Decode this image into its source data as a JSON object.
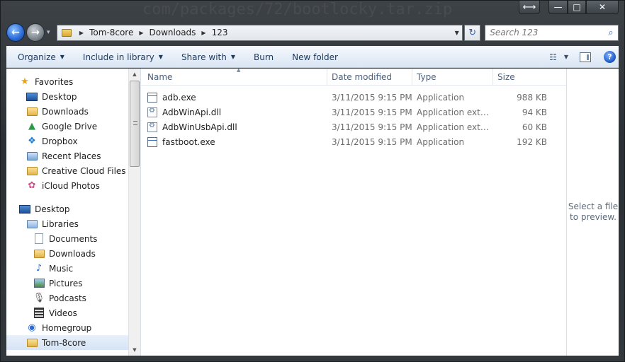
{
  "window": {
    "ghost_text": "com/packages/72/bootlocky.tar.zip",
    "caption": {
      "resize": "⟷",
      "minimize": "—",
      "maximize": "□",
      "close": "✕"
    }
  },
  "nav": {
    "back": "←",
    "forward": "→",
    "history_drop": "▾",
    "breadcrumbs": [
      "Tom-8core",
      "Downloads",
      "123"
    ],
    "address_drop": "▼",
    "refresh": "↻",
    "search_placeholder": "Search 123",
    "search_icon": "⌕"
  },
  "toolbar": {
    "organize": "Organize",
    "include_in_library": "Include in library",
    "share_with": "Share with",
    "burn": "Burn",
    "new_folder": "New folder",
    "view_icon": "☷",
    "help": "?"
  },
  "sidebar": {
    "favorites": {
      "label": "Favorites",
      "items": [
        "Desktop",
        "Downloads",
        "Google Drive",
        "Dropbox",
        "Recent Places",
        "Creative Cloud Files",
        "iCloud Photos"
      ]
    },
    "tree": {
      "desktop": "Desktop",
      "libraries": "Libraries",
      "library_items": [
        "Documents",
        "Downloads",
        "Music",
        "Pictures",
        "Podcasts",
        "Videos"
      ],
      "homegroup": "Homegroup",
      "user": "Tom-8core"
    }
  },
  "columns": {
    "name": "Name",
    "date": "Date modified",
    "type": "Type",
    "size": "Size"
  },
  "files": [
    {
      "name": "adb.exe",
      "date": "3/11/2015 9:15 PM",
      "type": "Application",
      "size": "988 KB",
      "icon": "app-icon"
    },
    {
      "name": "AdbWinApi.dll",
      "date": "3/11/2015 9:15 PM",
      "type": "Application extens...",
      "size": "94 KB",
      "icon": "dll-icon"
    },
    {
      "name": "AdbWinUsbApi.dll",
      "date": "3/11/2015 9:15 PM",
      "type": "Application extens...",
      "size": "60 KB",
      "icon": "dll-icon"
    },
    {
      "name": "fastboot.exe",
      "date": "3/11/2015 9:15 PM",
      "type": "Application",
      "size": "192 KB",
      "icon": "app-icon"
    }
  ],
  "preview": {
    "line1": "Select a file",
    "line2": "to preview."
  }
}
